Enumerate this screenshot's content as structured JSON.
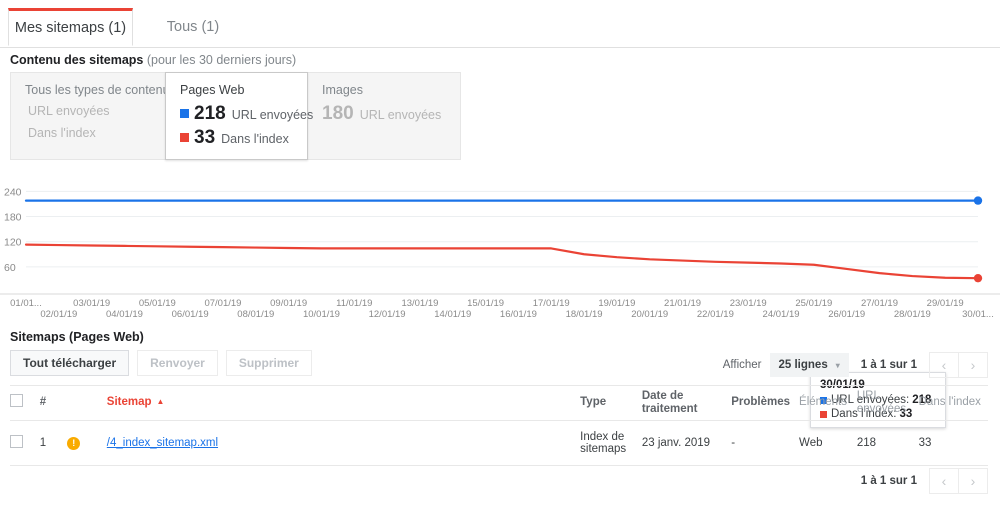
{
  "tabs": [
    {
      "label": "Mes sitemaps (1)",
      "active": true
    },
    {
      "label": "Tous (1)",
      "active": false
    }
  ],
  "section": {
    "title_bold": "Contenu des sitemaps",
    "title_note": " (pour les 30 derniers jours)"
  },
  "cards": [
    {
      "title": "Tous les types de contenu",
      "ghost_lines": [
        "URL envoyées",
        "Dans l'index"
      ],
      "selected": false
    },
    {
      "title": "Pages Web",
      "selected": true,
      "metrics": [
        {
          "color": "#1a73e8",
          "value": "218",
          "label": "URL envoyées"
        },
        {
          "color": "#ea4335",
          "value": "33",
          "label": "Dans l'index"
        }
      ]
    },
    {
      "title": "Images",
      "selected": false,
      "metrics": [
        {
          "color": "",
          "value": "180",
          "label": "URL envoyées"
        }
      ]
    }
  ],
  "tooltip": {
    "date": "30/01/19",
    "rows": [
      {
        "color": "#1a73e8",
        "label": "URL envoyées:",
        "value": "218"
      },
      {
        "color": "#ea4335",
        "label": "Dans l'index:",
        "value": "33"
      }
    ]
  },
  "chart_data": {
    "type": "line",
    "title": "Contenu des sitemaps (pour les 30 derniers jours)",
    "xlabel": "",
    "ylabel": "",
    "ylim": [
      0,
      260
    ],
    "yticks": [
      60,
      120,
      180,
      240
    ],
    "grid": true,
    "legend_position": "none",
    "x": [
      "01/01...",
      "02/01/19",
      "03/01/19",
      "04/01/19",
      "05/01/19",
      "06/01/19",
      "07/01/19",
      "08/01/19",
      "09/01/19",
      "10/01/19",
      "11/01/19",
      "12/01/19",
      "13/01/19",
      "14/01/19",
      "15/01/19",
      "16/01/19",
      "17/01/19",
      "18/01/19",
      "19/01/19",
      "20/01/19",
      "21/01/19",
      "22/01/19",
      "23/01/19",
      "24/01/19",
      "25/01/19",
      "26/01/19",
      "27/01/19",
      "28/01/19",
      "29/01/19",
      "30/01..."
    ],
    "series": [
      {
        "name": "URL envoyées",
        "color": "#1a73e8",
        "values": [
          218,
          218,
          218,
          218,
          218,
          218,
          218,
          218,
          218,
          218,
          218,
          218,
          218,
          218,
          218,
          218,
          218,
          218,
          218,
          218,
          218,
          218,
          218,
          218,
          218,
          218,
          218,
          218,
          218,
          218
        ]
      },
      {
        "name": "Dans l'index",
        "color": "#ea4335",
        "values": [
          113,
          112,
          111,
          110,
          109,
          108,
          107,
          106,
          105,
          104,
          104,
          104,
          104,
          104,
          104,
          104,
          104,
          90,
          83,
          78,
          75,
          72,
          70,
          68,
          65,
          55,
          45,
          38,
          34,
          33
        ]
      }
    ],
    "endpoint_labels": {
      "URL envoyées": 218,
      "Dans l'index": 33
    }
  },
  "table_section": {
    "title": "Sitemaps (Pages Web)",
    "buttons": [
      {
        "label": "Tout télécharger",
        "disabled": false
      },
      {
        "label": "Renvoyer",
        "disabled": true
      },
      {
        "label": "Supprimer",
        "disabled": true
      }
    ],
    "pager": {
      "afficher_label": "Afficher",
      "rows_per_page": "25 lignes",
      "caret": "▾",
      "range": "1 à 1 sur 1",
      "prev_icon": "‹",
      "next_icon": "›"
    },
    "columns": {
      "num": "#",
      "sitemap": "Sitemap",
      "sort_arrow": "▲",
      "type": "Type",
      "date": "Date de traitement",
      "date_l1": "Date de",
      "date_l2": "traitement",
      "problemes": "Problèmes",
      "elements": "Éléments",
      "url_envoyees": "URL envoyées",
      "url_l1": "URL",
      "url_l2": "envoyées",
      "dans_index": "Dans l'index"
    },
    "rows": [
      {
        "num": "1",
        "warning": "!",
        "sitemap": "/4_index_sitemap.xml",
        "type_l1": "Index de",
        "type_l2": "sitemaps",
        "date": "23 janv. 2019",
        "problemes": "-",
        "elements": "Web",
        "url_envoyees": "218",
        "dans_index": "33"
      }
    ],
    "bottom_pager": {
      "range": "1 à 1 sur 1",
      "prev_icon": "‹",
      "next_icon": "›"
    }
  },
  "colors": {
    "accent_red": "#ea4335",
    "accent_blue": "#1a73e8",
    "link": "#1a73e8",
    "warning": "#f9ab00"
  }
}
